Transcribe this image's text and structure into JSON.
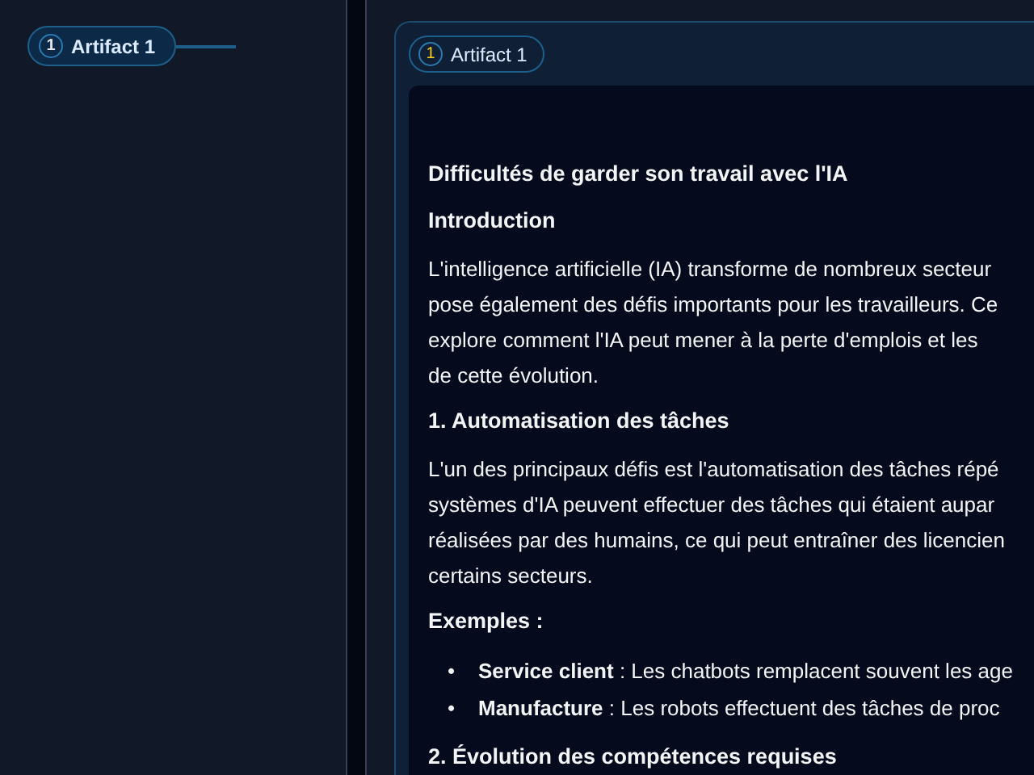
{
  "sidebar": {
    "artifact_tag": {
      "number": "1",
      "label": "Artifact 1"
    }
  },
  "artifact": {
    "tag": {
      "number": "1",
      "label": "Artifact 1"
    },
    "document": [
      {
        "kind": "title",
        "text": "Difficultés de garder son travail avec l'IA"
      },
      {
        "kind": "heading",
        "text": "Introduction"
      },
      {
        "kind": "paragraph",
        "lines": [
          "L'intelligence artificielle (IA) transforme de nombreux secteur",
          "pose également des défis importants pour les travailleurs. Ce",
          "explore comment l'IA peut mener à la perte d'emplois et les",
          "de cette évolution."
        ]
      },
      {
        "kind": "heading",
        "text": "1. Automatisation des tâches"
      },
      {
        "kind": "paragraph",
        "lines": [
          "L'un des principaux défis est l'automatisation des tâches répé",
          "systèmes d'IA peuvent effectuer des tâches qui étaient aupar",
          "réalisées par des humains, ce qui peut entraîner des licencien",
          "certains secteurs."
        ]
      },
      {
        "kind": "heading",
        "text": "Exemples :"
      },
      {
        "kind": "list",
        "items": [
          {
            "bullet": "•",
            "text": "**Service client** : Les chatbots remplacent souvent les age"
          },
          {
            "bullet": "•",
            "text": "**Manufacture** : Les robots effectuent des tâches de proc"
          }
        ]
      },
      {
        "kind": "heading",
        "text": "2. Évolution des compétences requises"
      }
    ]
  }
}
